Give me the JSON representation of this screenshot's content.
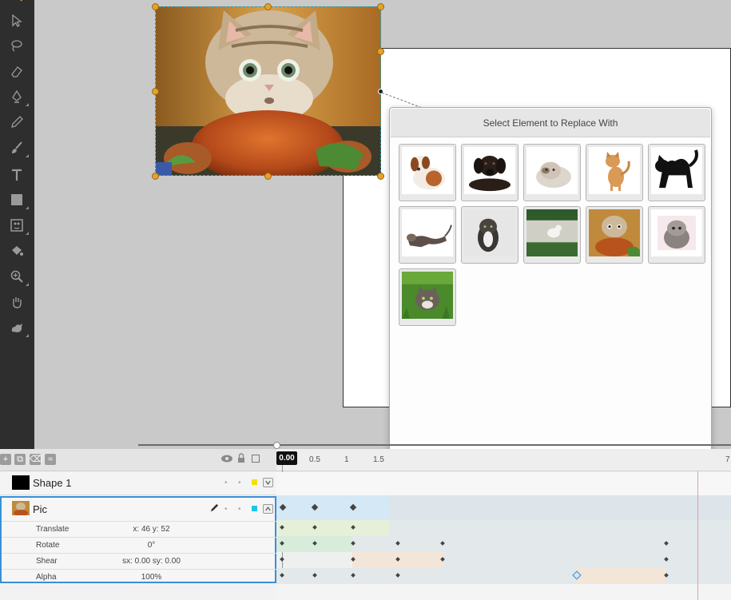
{
  "toolbar": {
    "tools": [
      "select-arrow-icon",
      "lasso-icon",
      "eraser-icon",
      "pen-icon",
      "pencil-icon",
      "brush-icon",
      "text-tool-icon",
      "rectangle-icon",
      "image-tool-icon",
      "fill-bucket-icon",
      "zoom-icon",
      "hand-icon",
      "bone-tool-icon"
    ]
  },
  "replace_panel": {
    "title": "Select Element to Replace With",
    "thumbnails": [
      "puppy-sitting",
      "black-puppy-lying",
      "fluffy-kitten",
      "orange-kitten-standing",
      "black-cat-arched",
      "kitten-stretching",
      "kitten-top-view",
      "kitten-on-road",
      "kitten-with-turkey",
      "grey-fluffy-kitten",
      "kitten-in-grass"
    ]
  },
  "timeline": {
    "current_time": "0.00",
    "ruler_labels": [
      "0.5",
      "1",
      "1.5",
      "7"
    ],
    "layers": [
      {
        "name": "Shape 1",
        "color": "#f1e000"
      },
      {
        "name": "Pic",
        "color": "#1ec6e6"
      }
    ],
    "properties": [
      {
        "name": "Translate",
        "value": "x: 46  y: 52"
      },
      {
        "name": "Rotate",
        "value": "0°"
      },
      {
        "name": "Shear",
        "value": "sx: 0.00  sy: 0.00"
      },
      {
        "name": "Alpha",
        "value": "100%"
      }
    ]
  }
}
